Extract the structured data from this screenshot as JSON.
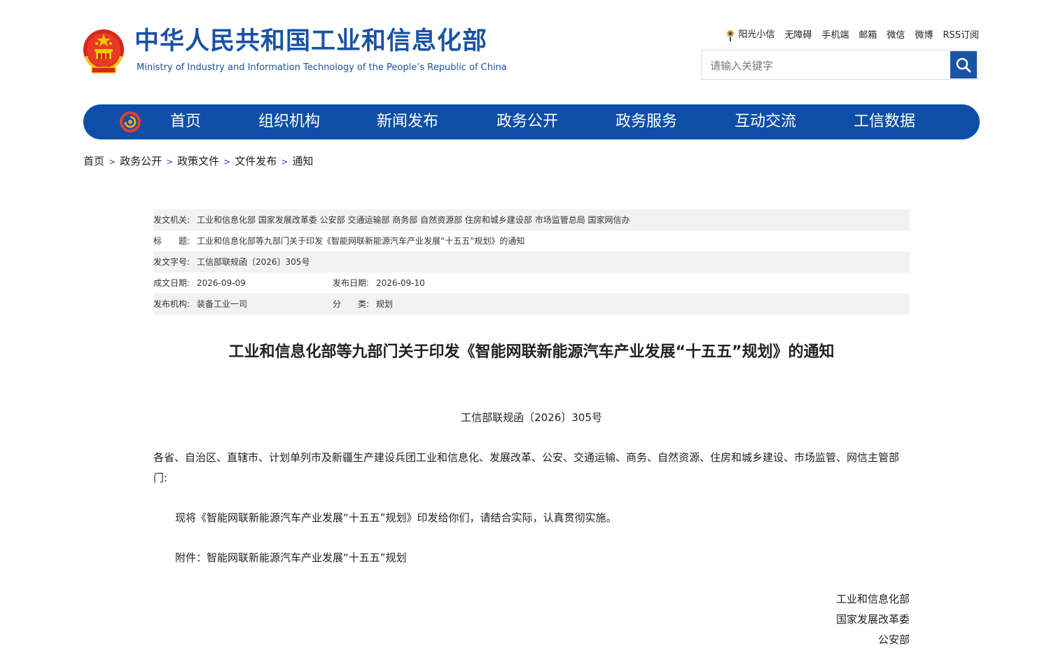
{
  "header": {
    "title_cn": "中华人民共和国工业和信息化部",
    "title_en": "Ministry of Industry and Information Technology of the People’s Republic of China",
    "top_links": [
      "阳光小信",
      "无障碍",
      "手机端",
      "邮箱",
      "微信",
      "微博",
      "RSS订阅"
    ],
    "search_placeholder": "请输入关键字"
  },
  "nav": {
    "items": [
      "首页",
      "组织机构",
      "新闻发布",
      "政务公开",
      "政务服务",
      "互动交流",
      "工信数据"
    ]
  },
  "breadcrumb": [
    "首页",
    "政务公开",
    "政策文件",
    "文件发布",
    "通知"
  ],
  "meta": {
    "issuer_label": "发文机关:",
    "issuer": "工业和信息化部 国家发展改革委 公安部 交通运输部 商务部 自然资源部 住房和城乡建设部 市场监管总局 国家网信办",
    "subject_label": "标　　题:",
    "subject": "工业和信息化部等九部门关于印发《智能网联新能源汽车产业发展“十五五”规划》的通知",
    "docno_label": "发文字号:",
    "docno": "工信部联规函〔2026〕305号",
    "written_label": "成文日期:",
    "written": "2026-09-09",
    "published_label": "发布日期:",
    "published": "2026-09-10",
    "org_label": "发布机构:",
    "org": "装备工业一司",
    "category_label": "分　　类:",
    "category": "规划"
  },
  "article": {
    "title": "工业和信息化部等九部门关于印发《智能网联新能源汽车产业发展“十五五”规划》的通知",
    "doc_no": "工信部联规函〔2026〕305号",
    "recipients": "各省、自治区、直辖市、计划单列市及新疆生产建设兵团工业和信息化、发展改革、公安、交通运输、商务、自然资源、住房和城乡建设、市场监管、网信主管部门:",
    "body": "现将《智能网联新能源汽车产业发展“十五五”规划》印发给你们，请结合实际，认真贯彻实施。",
    "attachment": "附件：智能网联新能源汽车产业发展“十五五”规划",
    "signatures": [
      "工业和信息化部",
      "国家发展改革委",
      "公安部"
    ]
  },
  "colors": {
    "brand_blue": "#1a52a5",
    "nav_blue": "#0e4ea8",
    "shade": "#f2f2f2"
  }
}
